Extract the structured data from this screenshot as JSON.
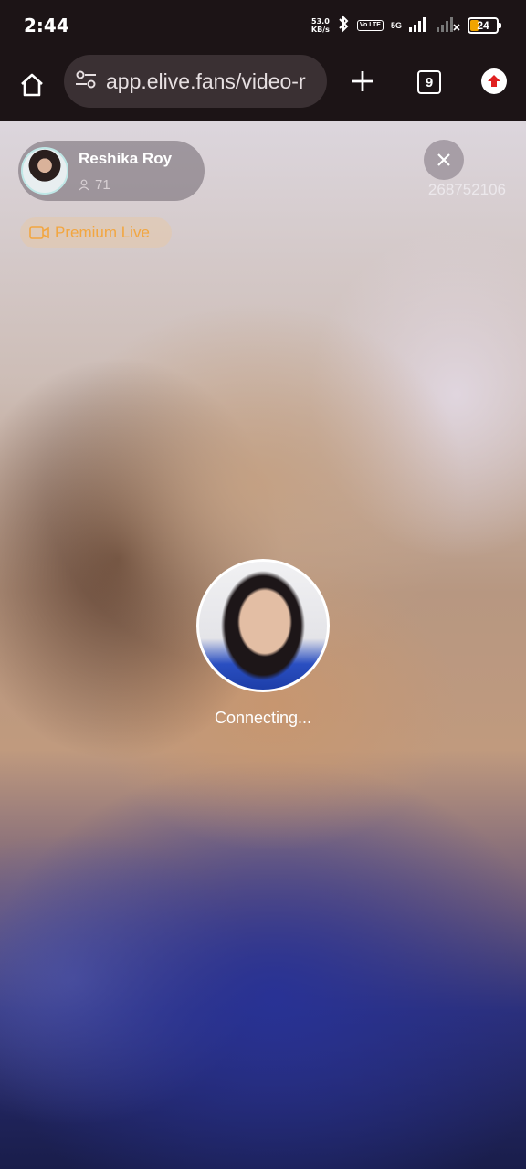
{
  "status_bar": {
    "time": "2:44",
    "net_speed_value": "53.0",
    "net_speed_unit": "KB/s",
    "volte_label": "Vo LTE",
    "network_label": "5G",
    "battery_level": "24"
  },
  "browser": {
    "url": "app.elive.fans/video-r",
    "tab_count": "9"
  },
  "stream": {
    "host_name": "Reshika Roy",
    "viewer_count": "71",
    "room_id": "268752106",
    "badge_label": "Premium Live",
    "status_text": "Connecting..."
  },
  "colors": {
    "accent_orange": "#f2a640",
    "toolbar_bg": "#1c1416",
    "url_field_bg": "#3a3033",
    "record_red": "#e02020"
  }
}
